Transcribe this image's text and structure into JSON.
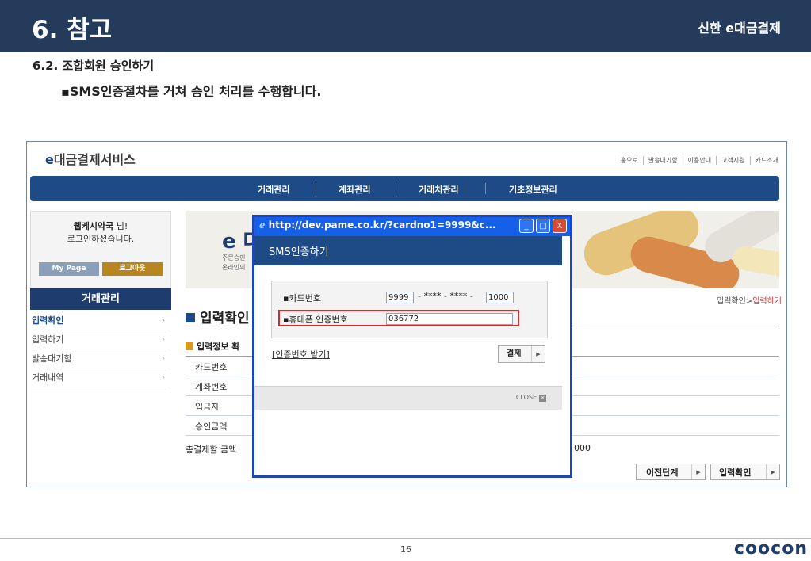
{
  "slide": {
    "title": "6. 참고",
    "brand": "신한 e대금결제",
    "section": "6.2. 조합회원 승인하기",
    "description": "▪SMS인증절차를 거쳐 승인 처리를 수행합니다.",
    "page_number": "16",
    "logo": "coocon"
  },
  "site": {
    "logo": "대금결제서비스",
    "logo_e": "e",
    "top_links": [
      "홈으로",
      "발송대기함",
      "이용안내",
      "고객지원",
      "카드소개"
    ],
    "gnb": [
      "거래관리",
      "계좌관리",
      "거래처관리",
      "기초정보관리"
    ]
  },
  "login": {
    "user": "웹케시약국",
    "suffix": " 님!",
    "message": "로그인하셨습니다.",
    "mypage": "My Page",
    "logout": "로그아웃"
  },
  "lnb": {
    "title": "거래관리",
    "items": [
      "입력확인",
      "입력하기",
      "발송대기함",
      "거래내역"
    ],
    "arrow": "›"
  },
  "banner": {
    "e": "e 대",
    "line1": "주문승인",
    "line2": "온라인의"
  },
  "content": {
    "breadcrumb_prefix": "입력확인>",
    "breadcrumb_current": "입력하기",
    "section_title": "입력확인",
    "sub_title": "입력정보 확",
    "rows": [
      "카드번호",
      "계좌번호",
      "입금자",
      "승인금액"
    ],
    "total_label": "총결제할 금액",
    "total_value": "000",
    "btn_prev": "이전단계",
    "btn_confirm": "입력확인"
  },
  "popup": {
    "url": "http://dev.pame.co.kr/?cardno1=9999&c...",
    "header": "SMS인증하기",
    "card_label": "▪카드번호",
    "card_part1": "9999",
    "card_mask": "- **** - **** -",
    "card_part4": "1000",
    "phone_label": "▪휴대폰 인증번호",
    "phone_value": "036772",
    "cert_link": "[인증번호 받기]",
    "pay_button": "결제",
    "close": "CLOSE",
    "win_buttons": [
      "_",
      "□",
      "X"
    ]
  },
  "colors": {
    "header_bg": "#243b5c",
    "nav_blue": "#1e4a86",
    "popup_border": "#1f45b5",
    "highlight_red": "#d42a2a",
    "accent_red": "#d0322b"
  }
}
